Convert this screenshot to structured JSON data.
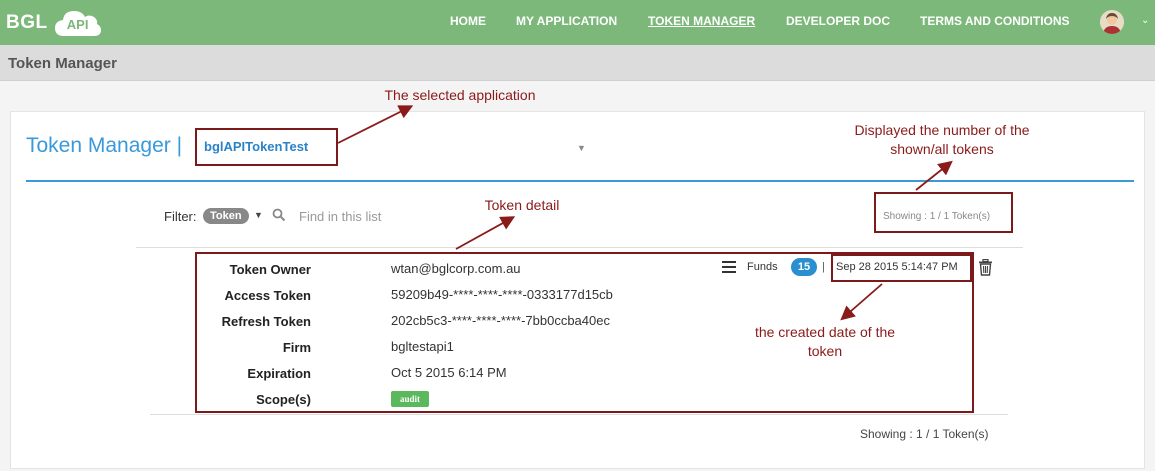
{
  "brand": {
    "name": "BGL",
    "cloud_label": "API"
  },
  "nav": {
    "items": [
      {
        "label": "HOME"
      },
      {
        "label": "MY APPLICATION"
      },
      {
        "label": "TOKEN MANAGER",
        "active": true
      },
      {
        "label": "DEVELOPER DOC"
      },
      {
        "label": "TERMS AND CONDITIONS"
      }
    ],
    "avatar_icon": "user-avatar-icon",
    "caret_icon": "chevron-down-icon"
  },
  "page": {
    "title": "Token Manager"
  },
  "manager": {
    "title": "Token Manager |",
    "selected_application": "bglAPITokenTest"
  },
  "filter": {
    "label": "Filter:",
    "pill": "Token",
    "search_placeholder": "Find in this list"
  },
  "showing": {
    "top": "Showing : 1 / 1 Token(s)",
    "bottom": "Showing : 1 / 1 Token(s)"
  },
  "token": {
    "labels": {
      "owner": "Token Owner",
      "access": "Access Token",
      "refresh": "Refresh Token",
      "firm": "Firm",
      "expiration": "Expiration",
      "scope": "Scope(s)"
    },
    "owner": "wtan@bglcorp.com.au",
    "access_token": "59209b49-****-****-****-0333177d15cb",
    "refresh_token": "202cb5c3-****-****-****-7bb0ccba40ec",
    "firm": "bgltestapi1",
    "expiration": "Oct 5 2015 6:14 PM",
    "scope": "audit",
    "funds_label": "Funds",
    "funds_count": "15",
    "separator": "|",
    "created": "Sep 28 2015 5:14:47 PM"
  },
  "annotations": {
    "selected_app": "The selected application",
    "count": "Displayed the number of the shown/all tokens",
    "detail": "Token detail",
    "created": "the created date of the token"
  },
  "colors": {
    "navbar": "#7cb87a",
    "accent_blue": "#3a9ad9",
    "annotation": "#8b1a1a",
    "scope_badge": "#5cb85c",
    "funds_badge": "#2a8fd0"
  }
}
